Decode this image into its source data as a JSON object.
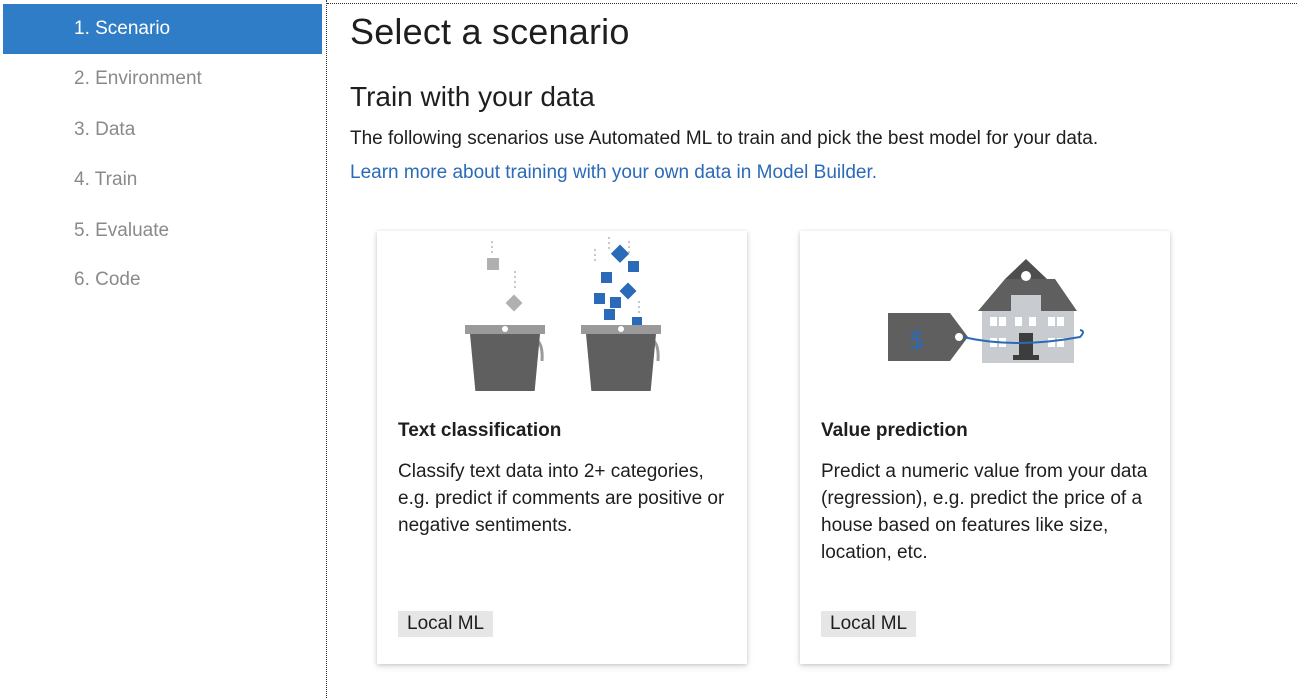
{
  "sidebar": {
    "steps": [
      {
        "label": "1. Scenario",
        "active": true
      },
      {
        "label": "2. Environment",
        "active": false
      },
      {
        "label": "3. Data",
        "active": false
      },
      {
        "label": "4. Train",
        "active": false
      },
      {
        "label": "5. Evaluate",
        "active": false
      },
      {
        "label": "6. Code",
        "active": false
      }
    ]
  },
  "main": {
    "title": "Select a scenario",
    "section_title": "Train with your data",
    "description": "The following scenarios use Automated ML to train and pick the best model for your data.",
    "learn_more_link": "Learn more about training with your own data in Model Builder.",
    "cards": [
      {
        "title": "Text classification",
        "description": "Classify text data into 2+ categories, e.g. predict if comments are positive or negative sentiments.",
        "badge": "Local ML",
        "icon": "buckets-icon"
      },
      {
        "title": "Value prediction",
        "description": "Predict a numeric value from your data (regression), e.g. predict the price of a house based on features like size, location, etc.",
        "badge": "Local ML",
        "icon": "house-price-icon",
        "tag_symbol": "$"
      }
    ]
  },
  "colors": {
    "accent": "#2f7dc6",
    "link": "#2a6ab8",
    "inactive_step": "#8a8a8a",
    "icon_dark": "#5f5f5f",
    "icon_blue": "#2a6ab8",
    "badge_bg": "#e6e6e6"
  }
}
